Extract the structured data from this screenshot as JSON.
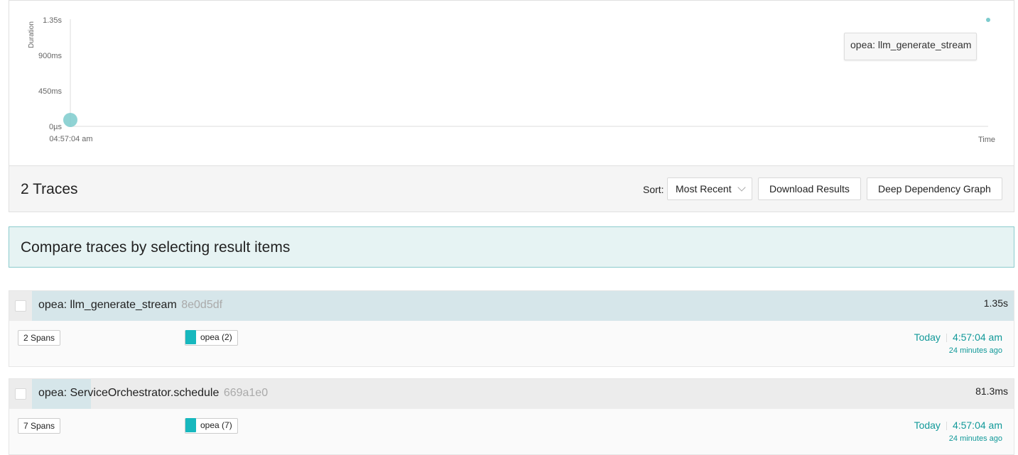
{
  "chart": {
    "ylabel": "Duration",
    "xlabel": "Time",
    "yticks": [
      "1.35s",
      "900ms",
      "450ms",
      "0µs"
    ],
    "xtick": "04:57:04 am",
    "tooltip": "opea: llm_generate_stream",
    "colors": {
      "point": "#7ccbcd",
      "axis": "#ddd"
    }
  },
  "chart_data": {
    "type": "scatter",
    "xlabel": "Time",
    "ylabel": "Duration",
    "yticks": [
      "0µs",
      "450ms",
      "900ms",
      "1.35s"
    ],
    "ylim_ms": [
      0,
      1350
    ],
    "x_ticks": [
      "04:57:04 am"
    ],
    "points": [
      {
        "name": "opea: ServiceOrchestrator.schedule",
        "x": "04:57:04 am",
        "duration_ms": 81.3,
        "size": "large"
      },
      {
        "name": "opea: llm_generate_stream",
        "x": "04:57:04 am",
        "duration_ms": 1350,
        "size": "small"
      }
    ]
  },
  "header": {
    "title": "2 Traces",
    "sort_label": "Sort:",
    "sort_value": "Most Recent",
    "download_label": "Download Results",
    "ddg_label": "Deep Dependency Graph"
  },
  "compare": {
    "text": "Compare traces by selecting result items"
  },
  "traces": [
    {
      "name": "opea: llm_generate_stream",
      "id": "8e0d5df",
      "duration": "1.35s",
      "spans": "2 Spans",
      "service": "opea (2)",
      "day": "Today",
      "time": "4:57:04 am",
      "ago": "24 minutes ago",
      "fill_fraction": 1.0
    },
    {
      "name": "opea: ServiceOrchestrator.schedule",
      "id": "669a1e0",
      "duration": "81.3ms",
      "spans": "7 Spans",
      "service": "opea (7)",
      "day": "Today",
      "time": "4:57:04 am",
      "ago": "24 minutes ago",
      "fill_fraction": 0.06
    }
  ]
}
